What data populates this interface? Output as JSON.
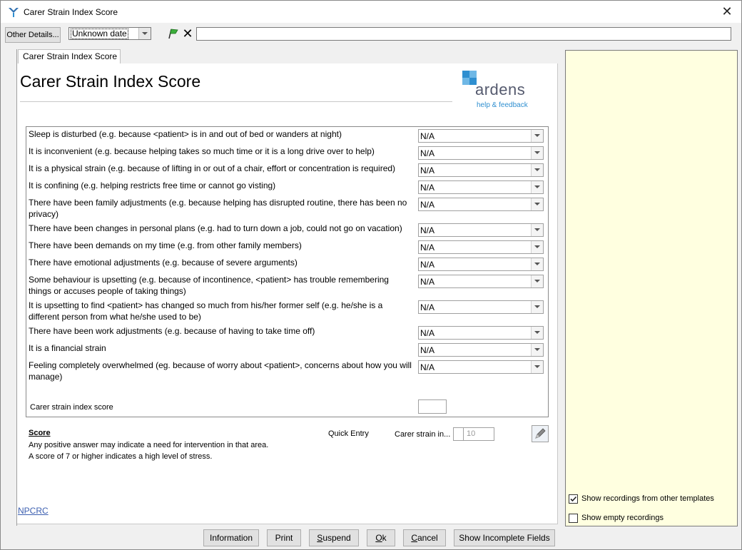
{
  "window": {
    "title": "Carer Strain Index Score"
  },
  "toolbar": {
    "other_details_label": "Other Details...",
    "date_value": "Unknown date",
    "free_text_value": ""
  },
  "tab": {
    "label": "Carer Strain Index Score"
  },
  "page": {
    "title": "Carer Strain Index Score"
  },
  "logo": {
    "word": "ardens",
    "tagline": "help & feedback"
  },
  "questions": [
    {
      "label": "Sleep is disturbed (e.g. because <patient> is in and out of bed or wanders at night)",
      "value": "N/A"
    },
    {
      "label": "It is inconvenient (e.g. because helping takes so much time or it is a long drive over to help)",
      "value": "N/A"
    },
    {
      "label": "It is a physical strain (e.g. because of lifting in or out of a chair, effort or concentration is required)",
      "value": "N/A"
    },
    {
      "label": "It is confining (e.g. helping restricts free time or cannot go visting)",
      "value": "N/A"
    },
    {
      "label": "There have been family adjustments (e.g. because helping has disrupted routine, there has been no privacy)",
      "value": "N/A"
    },
    {
      "label": "There have been changes in personal plans (e.g. had to turn down a job, could not go on vacation)",
      "value": "N/A"
    },
    {
      "label": "There have been demands on my time (e.g. from other family members)",
      "value": "N/A"
    },
    {
      "label": "There have emotional adjustments (e.g. because of severe arguments)",
      "value": "N/A"
    },
    {
      "label": "Some behaviour is upsetting (e.g. because of incontinence, <patient> has trouble remembering things or accuses people of taking things)",
      "value": "N/A"
    },
    {
      "label": "It is upsetting to find <patient> has changed so much from his/her former self (e.g. he/she is a different person from what he/she used to be)",
      "value": "N/A"
    },
    {
      "label": "There have been work adjustments (e.g. because of having to take time off)",
      "value": "N/A"
    },
    {
      "label": "It is a financial strain",
      "value": "N/A"
    },
    {
      "label": "Feeling completely overwhelmed (eg. because of worry about <patient>, concerns about how you will manage)",
      "value": "N/A"
    }
  ],
  "score_field": {
    "label": "Carer strain index score",
    "value": ""
  },
  "score_info": {
    "title": "Score",
    "line1": "Any positive answer may indicate a need for intervention in that area.",
    "line2": "A score of 7 or higher indicates a high level of stress."
  },
  "quick_entry": {
    "label": "Quick Entry",
    "field_label": "Carer strain in...",
    "value": "",
    "placeholder": "10"
  },
  "footer_link": "NPCRC",
  "right_panel": {
    "show_other_templates": {
      "label": "Show recordings from other templates",
      "checked": true
    },
    "show_empty": {
      "label": "Show empty recordings",
      "checked": false
    }
  },
  "buttons": {
    "information": "Information",
    "print": "Print",
    "suspend_first": "S",
    "suspend_rest": "uspend",
    "ok_first": "O",
    "ok_rest": "k",
    "cancel_first": "C",
    "cancel_rest": "ancel",
    "show_incomplete": "Show Incomplete Fields"
  },
  "colors": {
    "panel_bg": "#ffffe0",
    "logo_blue": "#2f8fd0",
    "link": "#3c5fb0"
  }
}
